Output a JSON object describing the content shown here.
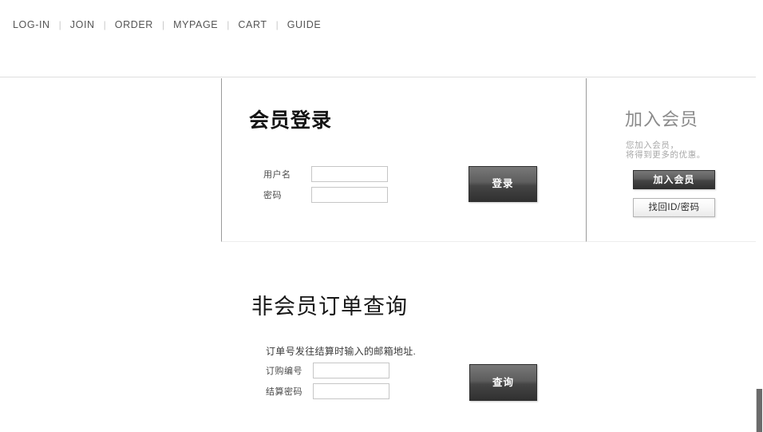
{
  "topnav": {
    "items": [
      {
        "label": "LOG-IN"
      },
      {
        "label": "JOIN"
      },
      {
        "label": "ORDER"
      },
      {
        "label": "MYPAGE"
      },
      {
        "label": "CART"
      },
      {
        "label": "GUIDE"
      }
    ],
    "separator": "|"
  },
  "login": {
    "title": "会员登录",
    "username_label": "用户名",
    "username_value": "",
    "password_label": "密码",
    "password_value": "",
    "submit_label": "登录"
  },
  "join": {
    "title": "加入会员",
    "desc_line1": "您加入会员，",
    "desc_line2": "将得到更多的优惠。",
    "join_button_label": "加入会员",
    "find_button_label": "找回ID/密码"
  },
  "nonmember": {
    "title": "非会员订单查询",
    "description": "订单号发往结算时输入的邮箱地址.",
    "order_no_label": "订购编号",
    "order_no_value": "",
    "settle_pw_label": "结算密码",
    "settle_pw_value": "",
    "submit_label": "查询"
  },
  "colors": {
    "page_background": "#ffffff",
    "nav_text": "#555555",
    "nav_separator": "#c9c9c9",
    "panel_border": "#9b9b9b",
    "heading_dark": "#141414",
    "heading_gray": "#8b8b8b",
    "muted_text": "#a8a8a8",
    "button_dark_top": "#787878",
    "button_dark_bottom": "#303030",
    "button_light_border": "#b4b4b4",
    "input_border": "#c6c6c6",
    "scrollbar_thumb": "#6b6b6b"
  }
}
